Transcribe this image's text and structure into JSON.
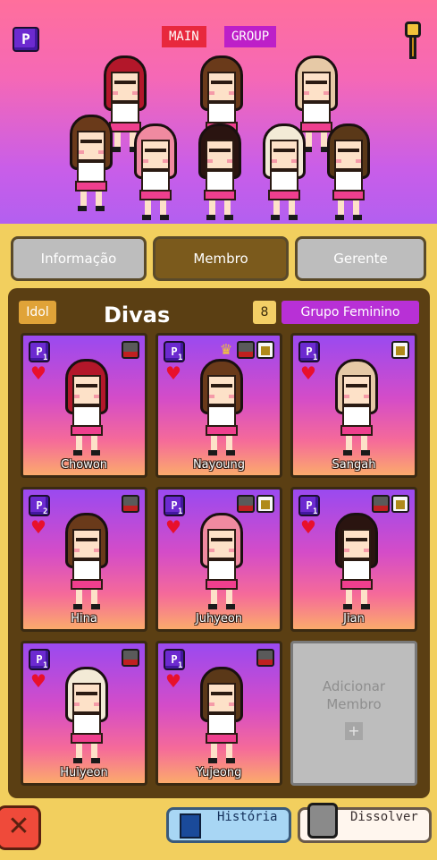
{
  "header": {
    "tag_main": "MAIN",
    "tag_group": "GROUP",
    "logo_icon": "pp-logo-icon",
    "right_icon": "microphone-icon"
  },
  "tabs": [
    {
      "label": "Informação"
    },
    {
      "label": "Membro"
    },
    {
      "label": "Gerente"
    }
  ],
  "group": {
    "idol_label": "Idol",
    "name": "Divas",
    "member_count": "8",
    "type": "Grupo Feminino"
  },
  "members": [
    {
      "name": "Chowon",
      "pp_level": "1",
      "hair": "#b3172a",
      "icons": [
        "mask"
      ]
    },
    {
      "name": "Nayoung",
      "pp_level": "1",
      "hair": "#6a3a1a",
      "icons": [
        "crown",
        "mask",
        "boot"
      ]
    },
    {
      "name": "Sangah",
      "pp_level": "1",
      "hair": "#e6c9a6",
      "icons": [
        "boot"
      ]
    },
    {
      "name": "Hina",
      "pp_level": "2",
      "hair": "#6a3a1a",
      "icons": [
        "mask"
      ]
    },
    {
      "name": "Juhyeon",
      "pp_level": "1",
      "hair": "#f08aa0",
      "icons": [
        "mask",
        "boot"
      ]
    },
    {
      "name": "Jian",
      "pp_level": "1",
      "hair": "#2a1410",
      "icons": [
        "mask",
        "boot"
      ]
    },
    {
      "name": "Huiyeon",
      "pp_level": "1",
      "hair": "#f3ead6",
      "icons": [
        "mask"
      ]
    },
    {
      "name": "Yujeong",
      "pp_level": "1",
      "hair": "#5a3818",
      "icons": [
        "mask"
      ]
    }
  ],
  "add_member": {
    "label_line1": "Adicionar",
    "label_line2": "Membro",
    "plus": "+"
  },
  "footer": {
    "close": "✕",
    "history_label": "História",
    "dissolve_label": "Dissolver"
  },
  "colors": {
    "banner_top": "#ff6f9c",
    "banner_bottom": "#b35ff0",
    "panel": "#5b3f13",
    "active_tab": "#7b5a1c",
    "main_tag": "#e8283d",
    "group_tag": "#bd1fc8"
  }
}
